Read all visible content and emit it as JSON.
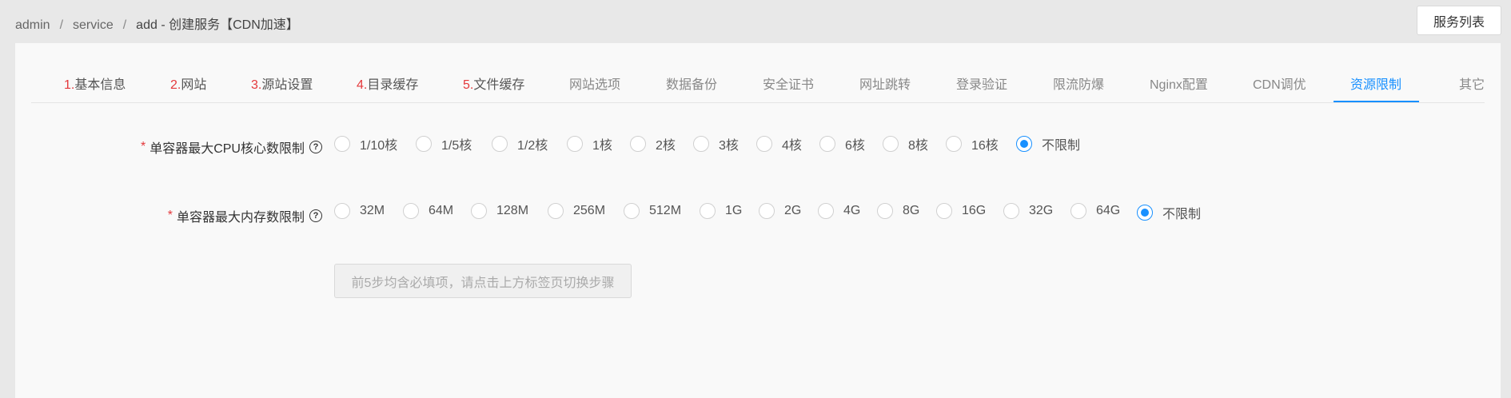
{
  "breadcrumb": {
    "items": [
      "admin",
      "service",
      "add"
    ],
    "separator": "/",
    "title": "- 创建服务【CDN加速】"
  },
  "header": {
    "list_button": "服务列表"
  },
  "tabs": [
    {
      "num": "1.",
      "label": "基本信息"
    },
    {
      "num": "2.",
      "label": "网站"
    },
    {
      "num": "3.",
      "label": "源站设置"
    },
    {
      "num": "4.",
      "label": "目录缓存"
    },
    {
      "num": "5.",
      "label": "文件缓存"
    },
    {
      "num": "",
      "label": "网站选项"
    },
    {
      "num": "",
      "label": "数据备份"
    },
    {
      "num": "",
      "label": "安全证书"
    },
    {
      "num": "",
      "label": "网址跳转"
    },
    {
      "num": "",
      "label": "登录验证"
    },
    {
      "num": "",
      "label": "限流防爆"
    },
    {
      "num": "",
      "label": "Nginx配置"
    },
    {
      "num": "",
      "label": "CDN调优"
    },
    {
      "num": "",
      "label": "资源限制"
    },
    {
      "num": "",
      "label": "其它"
    }
  ],
  "active_tab": "资源限制",
  "cpu_limit": {
    "required_mark": "*",
    "label": "单容器最大CPU核心数限制",
    "options": [
      "1/10核",
      "1/5核",
      "1/2核",
      "1核",
      "2核",
      "3核",
      "4核",
      "6核",
      "8核",
      "16核",
      "不限制"
    ],
    "selected": "不限制"
  },
  "memory_limit": {
    "required_mark": "*",
    "label": "单容器最大内存数限制",
    "options": [
      "32M",
      "64M",
      "128M",
      "256M",
      "512M",
      "1G",
      "2G",
      "4G",
      "8G",
      "16G",
      "32G",
      "64G",
      "不限制"
    ],
    "selected": "不限制"
  },
  "hint_button": "前5步均含必填项，请点击上方标签页切换步骤",
  "colors": {
    "accent": "#1890ff",
    "required": "#e4393c",
    "panel_bg": "#f9f9f9",
    "page_bg": "#e8e8e8"
  }
}
